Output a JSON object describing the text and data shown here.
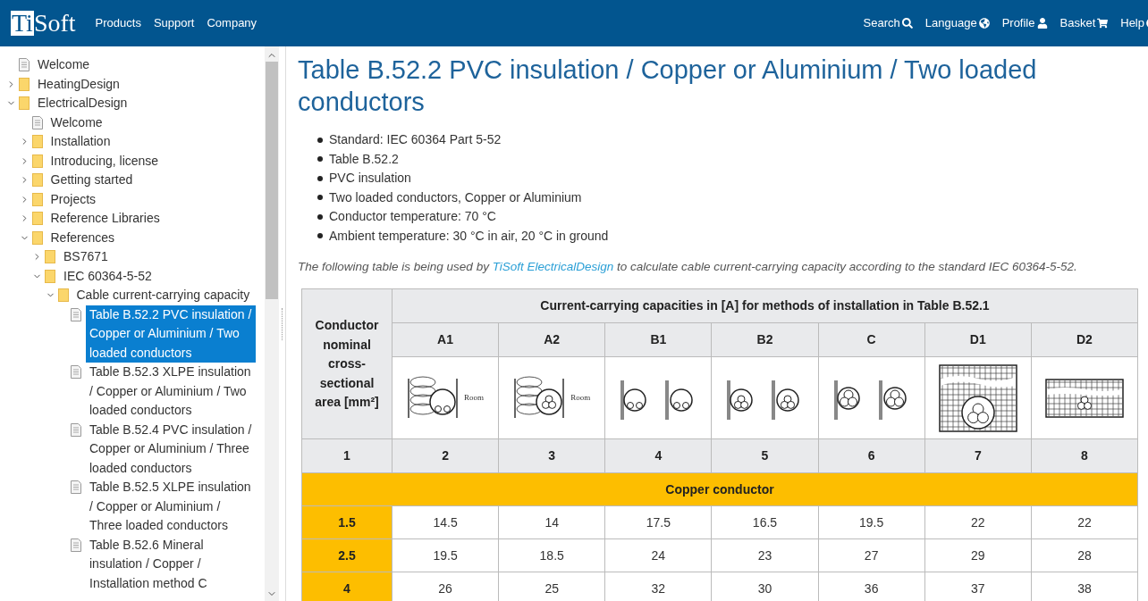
{
  "header": {
    "logo": {
      "boxed": "Ti",
      "rest": "Soft"
    },
    "nav": [
      {
        "label": "Products"
      },
      {
        "label": "Support"
      },
      {
        "label": "Company"
      }
    ],
    "actions": [
      {
        "label": "Search",
        "kind": "search"
      },
      {
        "label": "Language",
        "kind": "globe"
      },
      {
        "label": "Profile",
        "kind": "user"
      },
      {
        "label": "Basket",
        "kind": "cart"
      },
      {
        "label": "Help",
        "kind": "help"
      }
    ]
  },
  "sidebar": {
    "tree": [
      {
        "label": "Welcome",
        "kind": "page",
        "selected": false
      },
      {
        "label": "HeatingDesign",
        "kind": "folder",
        "expanded": false,
        "selected": false
      },
      {
        "label": "ElectricalDesign",
        "kind": "folder",
        "expanded": true,
        "selected": false,
        "children": [
          {
            "label": "Welcome",
            "kind": "page",
            "selected": false
          },
          {
            "label": "Installation",
            "kind": "folder",
            "expanded": false,
            "selected": false
          },
          {
            "label": "Introducing, license",
            "kind": "folder",
            "expanded": false,
            "selected": false
          },
          {
            "label": "Getting started",
            "kind": "folder",
            "expanded": false,
            "selected": false
          },
          {
            "label": "Projects",
            "kind": "folder",
            "expanded": false,
            "selected": false
          },
          {
            "label": "Reference Libraries",
            "kind": "folder",
            "expanded": false,
            "selected": false
          },
          {
            "label": "References",
            "kind": "folder",
            "expanded": true,
            "selected": false,
            "children": [
              {
                "label": "BS7671",
                "kind": "folder",
                "expanded": false,
                "selected": false
              },
              {
                "label": "IEC 60364-5-52",
                "kind": "folder",
                "expanded": true,
                "selected": false,
                "children": [
                  {
                    "label": "Cable current-carrying capacity",
                    "kind": "folder",
                    "expanded": true,
                    "selected": false,
                    "children": [
                      {
                        "label": "Table B.52.2 PVC insulation / Copper or Aluminium / Two loaded conductors",
                        "kind": "page",
                        "selected": true
                      },
                      {
                        "label": "Table B.52.3 XLPE insulation / Copper or Aluminium / Two loaded conductors",
                        "kind": "page",
                        "selected": false
                      },
                      {
                        "label": "Table B.52.4 PVC insulation / Copper or Aluminium / Three loaded conductors",
                        "kind": "page",
                        "selected": false
                      },
                      {
                        "label": "Table B.52.5 XLPE insulation / Copper or Aluminium / Three loaded conductors",
                        "kind": "page",
                        "selected": false
                      },
                      {
                        "label": "Table B.52.6 Mineral insulation / Copper / Installation method C",
                        "kind": "page",
                        "selected": false
                      }
                    ]
                  }
                ]
              }
            ]
          }
        ]
      }
    ]
  },
  "content": {
    "title": "Table B.52.2 PVC insulation / Copper or Aluminium / Two loaded conductors",
    "bullets": [
      "Standard: IEC 60364 Part 5-52",
      "Table B.52.2",
      "PVC insulation",
      "Two loaded conductors, Copper or Aluminium",
      "Conductor temperature: 70 °C",
      "Ambient temperature: 30 °C in air, 20 °C in ground"
    ],
    "intro": {
      "before": "The following table is being used by ",
      "link": "TiSoft ElectricalDesign",
      "after": " to calculate cable current-carrying capacity according to the standard IEC 60364-5-52."
    },
    "table": {
      "size_heading": "Conductor nominal cross-sectional area [mm²]",
      "capacities_heading": "Current-carrying capacities in [A] for methods of installation in Table B.52.1",
      "size_column_number": "1",
      "methods": [
        {
          "code": "A1",
          "number": "2",
          "kind": "insulated-wall-single",
          "diagram_label": "Room"
        },
        {
          "code": "A2",
          "number": "3",
          "kind": "insulated-wall-multicore",
          "diagram_label": "Room"
        },
        {
          "code": "B1",
          "number": "4",
          "kind": "conduit-single"
        },
        {
          "code": "B2",
          "number": "5",
          "kind": "conduit-multicore"
        },
        {
          "code": "C",
          "number": "6",
          "kind": "clipped-multicore"
        },
        {
          "code": "D1",
          "number": "7",
          "kind": "duct-in-ground"
        },
        {
          "code": "D2",
          "number": "8",
          "kind": "direct-in-ground"
        }
      ],
      "sections": [
        {
          "title": "Copper conductor",
          "rows": [
            {
              "size": "1.5",
              "values": [
                "14.5",
                "14",
                "17.5",
                "16.5",
                "19.5",
                "22",
                "22"
              ]
            },
            {
              "size": "2.5",
              "values": [
                "19.5",
                "18.5",
                "24",
                "23",
                "27",
                "29",
                "28"
              ]
            },
            {
              "size": "4",
              "values": [
                "26",
                "25",
                "32",
                "30",
                "36",
                "37",
                "38"
              ]
            }
          ]
        }
      ]
    }
  }
}
